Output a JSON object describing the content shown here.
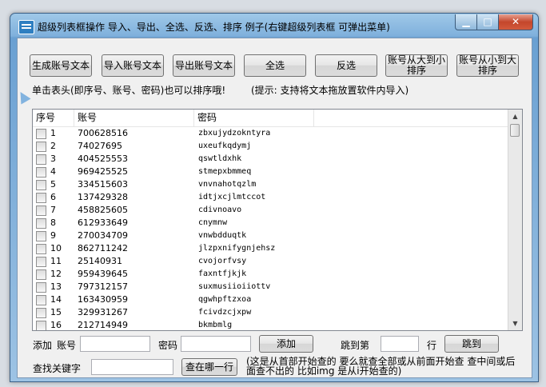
{
  "window": {
    "title": "超级列表框操作 导入、导出、全选、反选、排序 例子(右键超级列表框 可弹出菜单)",
    "min_glyph": "▁",
    "max_glyph": "□",
    "close_glyph": "✕"
  },
  "toolbar": {
    "generate": "生成账号文本",
    "import": "导入账号文本",
    "export": "导出账号文本",
    "select_all": "全选",
    "invert": "反选",
    "sort_desc": "账号从大到小排序",
    "sort_asc": "账号从小到大排序"
  },
  "hints": {
    "left": "单击表头(即序号、账号、密码)也可以排序哦!",
    "right": "(提示: 支持将文本拖放置软件内导入)"
  },
  "list": {
    "columns": [
      "序号",
      "账号",
      "密码"
    ],
    "rows": [
      {
        "idx": "1",
        "account": "700628516",
        "password": "zbxujydzokntyra"
      },
      {
        "idx": "2",
        "account": "74027695",
        "password": "uxeufkqdymj"
      },
      {
        "idx": "3",
        "account": "404525553",
        "password": "qswtldxhk"
      },
      {
        "idx": "4",
        "account": "969425525",
        "password": "stmepxbmmeq"
      },
      {
        "idx": "5",
        "account": "334515603",
        "password": "vnvnahotqzlm"
      },
      {
        "idx": "6",
        "account": "137429328",
        "password": "idtjxcjlmtccot"
      },
      {
        "idx": "7",
        "account": "458825605",
        "password": "cdivnoavo"
      },
      {
        "idx": "8",
        "account": "612933649",
        "password": "cnymnw"
      },
      {
        "idx": "9",
        "account": "270034709",
        "password": "vnwbdduqtk"
      },
      {
        "idx": "10",
        "account": "862711242",
        "password": "jlzpxnifygnjehsz"
      },
      {
        "idx": "11",
        "account": "25140931",
        "password": "cvojorfvsy"
      },
      {
        "idx": "12",
        "account": "959439645",
        "password": "faxntfjkjk"
      },
      {
        "idx": "13",
        "account": "797312157",
        "password": "suxmusiioiiottv"
      },
      {
        "idx": "14",
        "account": "163430959",
        "password": "qgwhpftzxoa"
      },
      {
        "idx": "15",
        "account": "329931267",
        "password": "fcivdzcjxpw"
      },
      {
        "idx": "16",
        "account": "212714949",
        "password": "bkmbmlg"
      }
    ]
  },
  "add_form": {
    "label_add": "添加",
    "label_account": "账号",
    "label_password": "密码",
    "account_value": "",
    "password_value": "",
    "add_button": "添加",
    "goto_label": "跳到第",
    "goto_value": "",
    "row_unit": "行",
    "goto_button": "跳到"
  },
  "search": {
    "label": "查找关键字",
    "value": "",
    "button": "查在哪一行",
    "note": "(这是从首部开始查的 要么就查全部或从前面开始查 查中间或后面查不出的 比如img 是从i开始查的)"
  }
}
